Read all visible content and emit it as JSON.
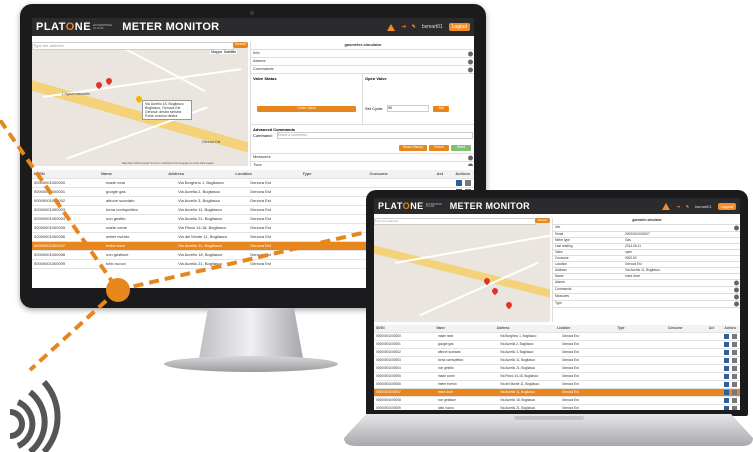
{
  "app": {
    "brand_prefix": "PLAT",
    "brand_o": "O",
    "brand_suffix": "NE",
    "brand_tag_top": "ENTERPRISE",
    "brand_tag_bottom": "CLOUD",
    "title": "METER MONITOR",
    "user": "bsmart01",
    "logout": "Logout"
  },
  "map": {
    "search_placeholder": "Type the address",
    "search_button": "Search",
    "mode_map": "Mappa",
    "mode_sat": "Satellite",
    "info_line1": "Via Aurelio 18, Bogliasco",
    "info_line2": "Bogliasco, Genova Est",
    "info_line3": "Genova: destra sinistra",
    "info_line4": "Porta: manica destra",
    "footer": "Map data ©2014 Google   Termini e condizioni d'uso   Segnala un errore nella mappa",
    "place1": "Genova Est",
    "place2": "L'Agave ristorante"
  },
  "panel": {
    "header": "gasmeter-simulator",
    "row_info": "Info",
    "row_alarms": "Alarms",
    "row_commands": "Commands",
    "valve_title": "Valve Status",
    "close_valve": "Close Valve",
    "open_valve_title": "Open Valve",
    "set_cycle_label": "Set Cycle:",
    "set_cycle_value": "90",
    "set_button": "Set",
    "advanced_title": "Advanced Commands",
    "command_label": "Command:",
    "command_placeholder": "Select a command",
    "show_history": "Show History",
    "reset": "Reset",
    "send": "Send",
    "row_measures": "Measures",
    "row_type": "Type"
  },
  "table": {
    "headers": [
      "ID/SN",
      "Name",
      "Address",
      "Location",
      "Type",
      "Consume",
      "Act",
      "Actions"
    ],
    "rows": [
      [
        "00000001000000",
        "made near",
        "Via Borghino 1, Bogliasco",
        "Genova Est"
      ],
      [
        "00000001000001",
        "google gas",
        "Via Aurelia 2, Bogliasco",
        "Genova Est"
      ],
      [
        "00000001000002",
        "altrove scordato",
        "Via Aurelio 3, Bogliasco",
        "Genova Est"
      ],
      [
        "00000001000003",
        "torna corrispettivo",
        "Via Aurelio 11, Bogliasco",
        "Genova Est"
      ],
      [
        "00000001000004",
        "non gestito",
        "Via Aurelio 21, Bogliasco",
        "Genova Est"
      ],
      [
        "00000001000005",
        "made come",
        "Via Piano 14-18, Bogliasco",
        "Genova Est"
      ],
      [
        "00000001000006",
        "meter evento",
        "Via del Monte 11, Bogliasco",
        "Genova Est"
      ],
      [
        "00000001000007",
        "entra dove",
        "Via Aurelio 11, Bogliasco",
        "Genova Est"
      ],
      [
        "00000001000008",
        "non gestisce",
        "Via Aurelio 18, Bogliasco",
        "Genova Est"
      ],
      [
        "00000001000009",
        "tutto nuovo",
        "Via Aurelio 21, Bogliasco",
        "Genova Est"
      ]
    ],
    "selected_index": 7
  },
  "laptop_info": {
    "rows": [
      [
        "Serial",
        "00000001000007"
      ],
      [
        "Meter type",
        "Gas"
      ],
      [
        "Last reading",
        "2014-06-11"
      ],
      [
        "Valve",
        "open"
      ],
      [
        "Consume",
        "0000.00"
      ],
      [
        "Location",
        "Genova Est"
      ],
      [
        "Address",
        "Via Aurelio 11, Bogliasco"
      ],
      [
        "Name",
        "entra dove"
      ]
    ]
  },
  "colors": {
    "accent": "#e8861e",
    "header_bg": "#2b2b2d",
    "bezel": "#1b1b1d",
    "dash": "#e8861e"
  }
}
